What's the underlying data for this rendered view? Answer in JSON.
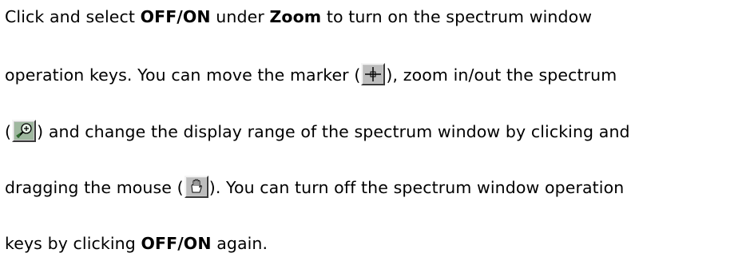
{
  "paragraph": {
    "line1": {
      "pre": "Click and select ",
      "offon": "OFF/ON",
      "mid": " under ",
      "zoom": "Zoom",
      "post": " to turn on the spectrum window"
    },
    "line2": {
      "pre": "operation keys. You can move the marker (",
      "post": "), zoom in/out the spectrum"
    },
    "line3": {
      "pre": "(",
      "post": ") and change the display range of the spectrum window by clicking and"
    },
    "line4": {
      "pre": "dragging the mouse (",
      "post": "). You can turn off the spectrum window operation"
    },
    "line5": {
      "pre": "keys by clicking ",
      "offon": "OFF/ON",
      "post": " again."
    }
  },
  "icons": {
    "marker": "crosshair-marker-icon",
    "zoom": "zoom-magnifier-icon",
    "drag": "hand-drag-icon"
  }
}
